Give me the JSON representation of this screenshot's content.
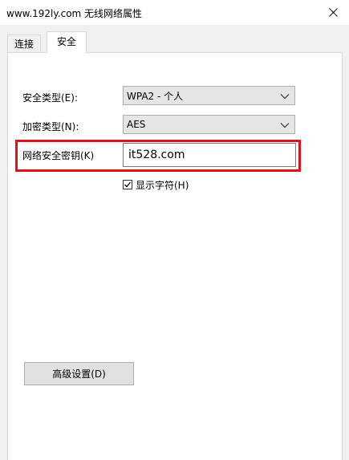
{
  "window": {
    "title": "www.192ly.com 无线网络属性"
  },
  "tabs": [
    {
      "label": "连接"
    },
    {
      "label": "安全"
    }
  ],
  "security": {
    "security_type_label": "安全类型(E):",
    "security_type_value": "WPA2 - 个人",
    "encryption_type_label": "加密类型(N):",
    "encryption_type_value": "AES",
    "network_key_label": "网络安全密钥(K)",
    "network_key_value": "it528.com",
    "show_characters_label": "显示字符(H)",
    "show_characters_checked": true,
    "advanced_button_label": "高级设置(D)"
  },
  "colors": {
    "highlight": "#e0131a",
    "window_bg": "#f0f0f0",
    "panel_bg": "#ffffff"
  },
  "icons": {
    "close": "close-icon",
    "dropdown": "chevron-down-icon",
    "check": "check-icon"
  }
}
